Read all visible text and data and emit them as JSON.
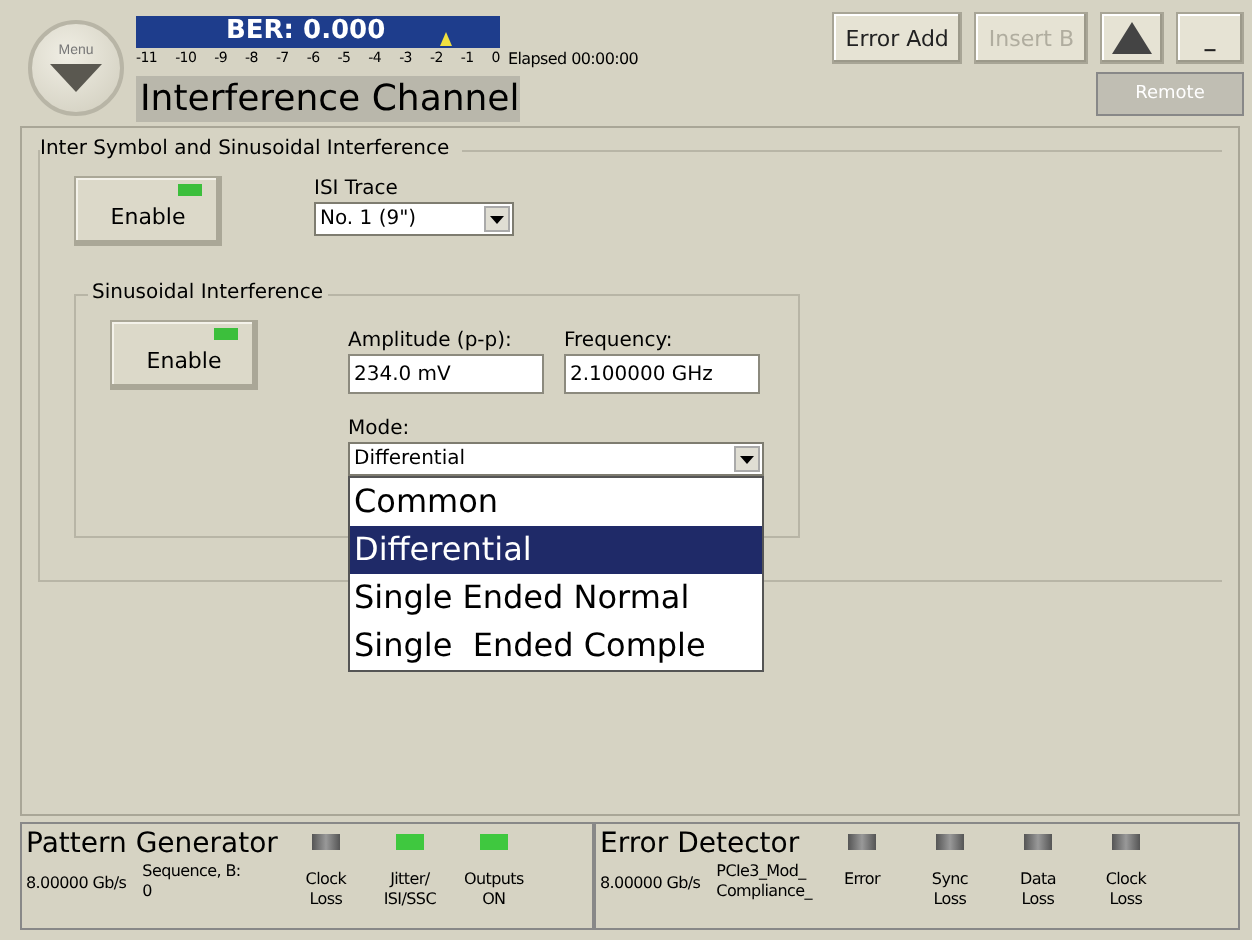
{
  "header": {
    "menu_button": {
      "label": "Menu"
    },
    "ber": {
      "title": "BER: 0.000",
      "scale": [
        "-11",
        "-10",
        "-9",
        "-8",
        "-7",
        "-6",
        "-5",
        "-4",
        "-3",
        "-2",
        "-1",
        "0"
      ]
    },
    "elapsed": "Elapsed 00:00:00",
    "title": "Interference Channel",
    "buttons": [
      {
        "label": "Error Add",
        "disabled": false
      },
      {
        "label": "Insert B",
        "disabled": true
      }
    ],
    "minimize": "_",
    "remote": "Remote"
  },
  "isi_group": {
    "title": "Inter Symbol and Sinusoidal Interference",
    "enable": {
      "label": "Enable",
      "on": true
    },
    "isi_trace": {
      "label": "ISI Trace",
      "value": "No. 1 (9\")"
    }
  },
  "sin_group": {
    "title": "Sinusoidal Interference",
    "enable": {
      "label": "Enable",
      "on": true
    },
    "amplitude": {
      "label": "Amplitude (p-p):",
      "value": "234.0 mV"
    },
    "frequency": {
      "label": "Frequency:",
      "value": "2.100000 GHz"
    },
    "mode": {
      "label": "Mode:",
      "value": "Differential",
      "options": [
        {
          "label": "Common",
          "selected": false
        },
        {
          "label": "Differential",
          "selected": true
        },
        {
          "label": "Single Ended Normal",
          "selected": false
        },
        {
          "label": "Single  Ended Comple",
          "selected": false
        }
      ]
    }
  },
  "status_bar": {
    "pattern_generator": {
      "title": "Pattern Generator",
      "rate": "8.00000 Gb/s",
      "info": "Sequence, B:\n0",
      "indicators": [
        {
          "label": "Clock\nLoss",
          "on": false
        },
        {
          "label": "Jitter/\nISI/SSC",
          "on": true
        },
        {
          "label": "Outputs\nON",
          "on": true
        }
      ]
    },
    "error_detector": {
      "title": "Error Detector",
      "rate": "8.00000 Gb/s",
      "info": "PCIe3_Mod_\nCompliance_",
      "indicators": [
        {
          "label": "Error",
          "on": false
        },
        {
          "label": "Sync\nLoss",
          "on": false
        },
        {
          "label": "Data\nLoss",
          "on": false
        },
        {
          "label": "Clock\nLoss",
          "on": false
        }
      ]
    }
  }
}
